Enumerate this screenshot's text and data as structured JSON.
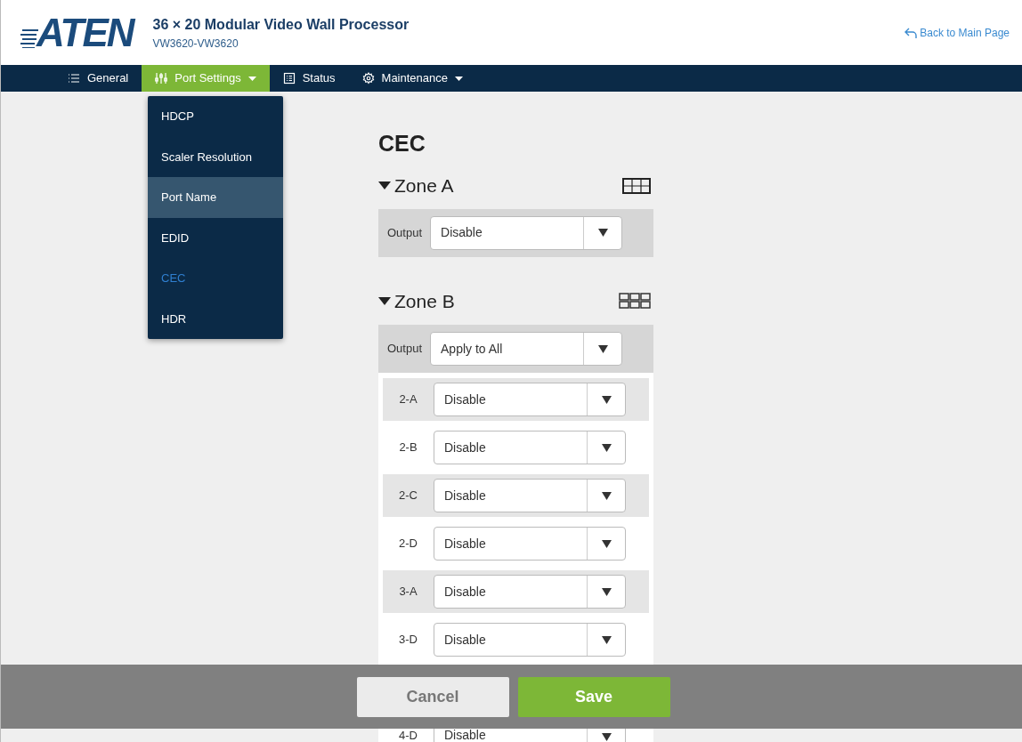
{
  "header": {
    "logo": "ATEN",
    "title": "36 × 20 Modular Video Wall Processor",
    "subtitle": "VW3620-VW3620",
    "back_link": "Back to Main Page"
  },
  "nav": [
    {
      "label": "General",
      "kind": "list",
      "caret": false,
      "selected": false
    },
    {
      "label": "Port Settings",
      "kind": "sliders",
      "caret": true,
      "selected": true
    },
    {
      "label": "Status",
      "kind": "status",
      "caret": false,
      "selected": false
    },
    {
      "label": "Maintenance",
      "kind": "gear",
      "caret": true,
      "selected": false
    }
  ],
  "port_menu": [
    {
      "label": "HDCP",
      "highlighted": false,
      "selected": false
    },
    {
      "label": "Scaler Resolution",
      "highlighted": false,
      "selected": false
    },
    {
      "label": "Port Name",
      "highlighted": true,
      "selected": false
    },
    {
      "label": "EDID",
      "highlighted": false,
      "selected": false
    },
    {
      "label": "CEC",
      "highlighted": false,
      "selected": true
    },
    {
      "label": "HDR",
      "highlighted": false,
      "selected": false
    }
  ],
  "page_title": "CEC",
  "zones": [
    {
      "title": "Zone A",
      "expanded": true,
      "kind": "grid",
      "output_label": "Output",
      "output_value": "Disable"
    },
    {
      "title": "Zone B",
      "expanded": true,
      "kind": "tiles",
      "output_label": "Output",
      "output_value": "Apply to All",
      "ports": [
        {
          "label": "2-A",
          "value": "Disable"
        },
        {
          "label": "2-B",
          "value": "Disable"
        },
        {
          "label": "2-C",
          "value": "Disable"
        },
        {
          "label": "2-D",
          "value": "Disable"
        },
        {
          "label": "3-A",
          "value": "Disable"
        },
        {
          "label": "3-D",
          "value": "Disable"
        }
      ]
    }
  ],
  "cut_off_row": {
    "label": "4-D",
    "value": "Disable"
  },
  "footer": {
    "cancel": "Cancel",
    "save": "Save"
  }
}
